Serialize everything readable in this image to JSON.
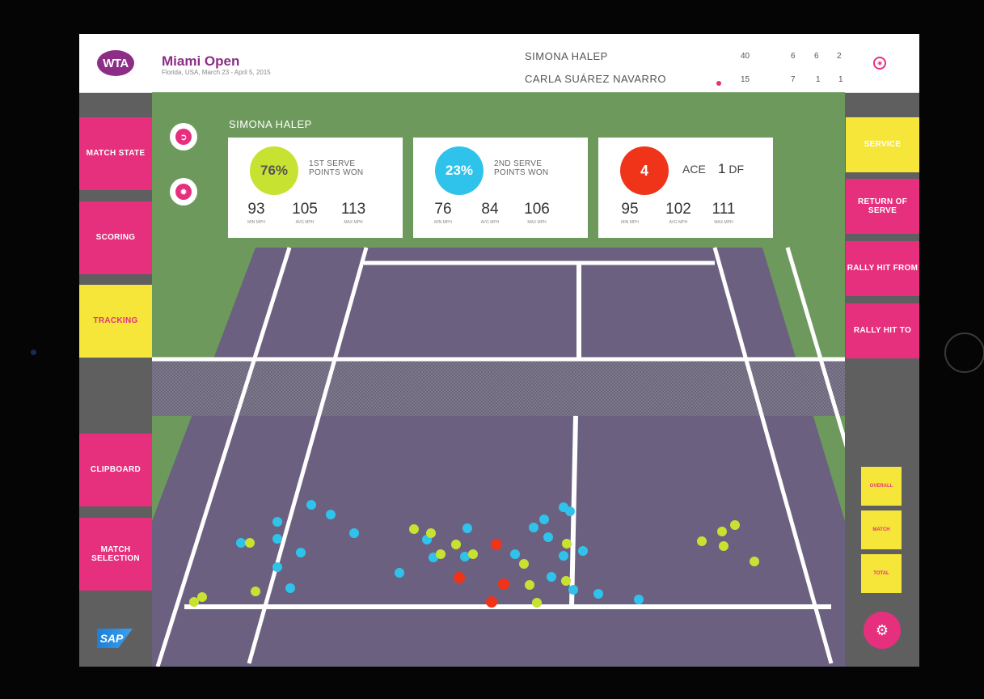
{
  "header": {
    "logo_text": "WTA",
    "event_name": "Miami Open",
    "event_sub": "Florida, USA, March 23 - April 5, 2015",
    "players": [
      {
        "name": "SIMONA HALEP",
        "point": "40",
        "sets": [
          "6",
          "6",
          "2"
        ],
        "serving": false
      },
      {
        "name": "CARLA SUÁREZ NAVARRO",
        "point": "15",
        "sets": [
          "7",
          "1",
          "1"
        ],
        "serving": true
      }
    ]
  },
  "left_nav": {
    "match_state": "MATCH STATE",
    "scoring": "SCORING",
    "tracking": "TRACKING",
    "clipboard": "CLIPBOARD",
    "match_selection": "MATCH SELECTION",
    "sponsor": "SAP"
  },
  "panel": {
    "player_name": "SIMONA HALEP",
    "patterns": [
      {
        "icon": "serve-pattern-icon",
        "label": "Serve Pattern"
      },
      {
        "icon": "outdoor-pattern-icon",
        "label": "Outdoor Heat"
      }
    ],
    "cards": [
      {
        "badge": "76%",
        "label_line1": "1ST SERVE",
        "label_line2": "POINTS WON",
        "stats": [
          {
            "v": "93",
            "u": "MIN MPH"
          },
          {
            "v": "105",
            "u": "AVG MPH"
          },
          {
            "v": "113",
            "u": "MAX MPH"
          }
        ]
      },
      {
        "badge": "23%",
        "label_line1": "2ND SERVE",
        "label_line2": "POINTS WON",
        "stats": [
          {
            "v": "76",
            "u": "MIN MPH"
          },
          {
            "v": "84",
            "u": "AVG MPH"
          },
          {
            "v": "106",
            "u": "MAX MPH"
          }
        ]
      },
      {
        "badge": "4",
        "ace_label": "ACE",
        "df_value": "1",
        "df_label": "DF",
        "stats": [
          {
            "v": "95",
            "u": "MIN MPH"
          },
          {
            "v": "102",
            "u": "AVG MPH"
          },
          {
            "v": "111",
            "u": "MAX MPH"
          }
        ]
      }
    ]
  },
  "right_nav": {
    "service": "SERVICE",
    "return_of_serve": "RETURN OF SERVE",
    "rally_hit_from": "RALLY HIT FROM",
    "rally_hit_to": "RALLY HIT TO",
    "filters": [
      "OVERALL",
      "MATCH",
      "TOTAL"
    ],
    "settings_icon": "settings-gear-icon"
  },
  "colors": {
    "brand_pink": "#e6307d",
    "brand_yellow": "#f7e63a",
    "court_purple": "#6c6080",
    "surround_green": "#6d9a5c",
    "dot_cyan": "#2fc3ec",
    "dot_lime": "#c8e232",
    "dot_red": "#f0341a"
  }
}
